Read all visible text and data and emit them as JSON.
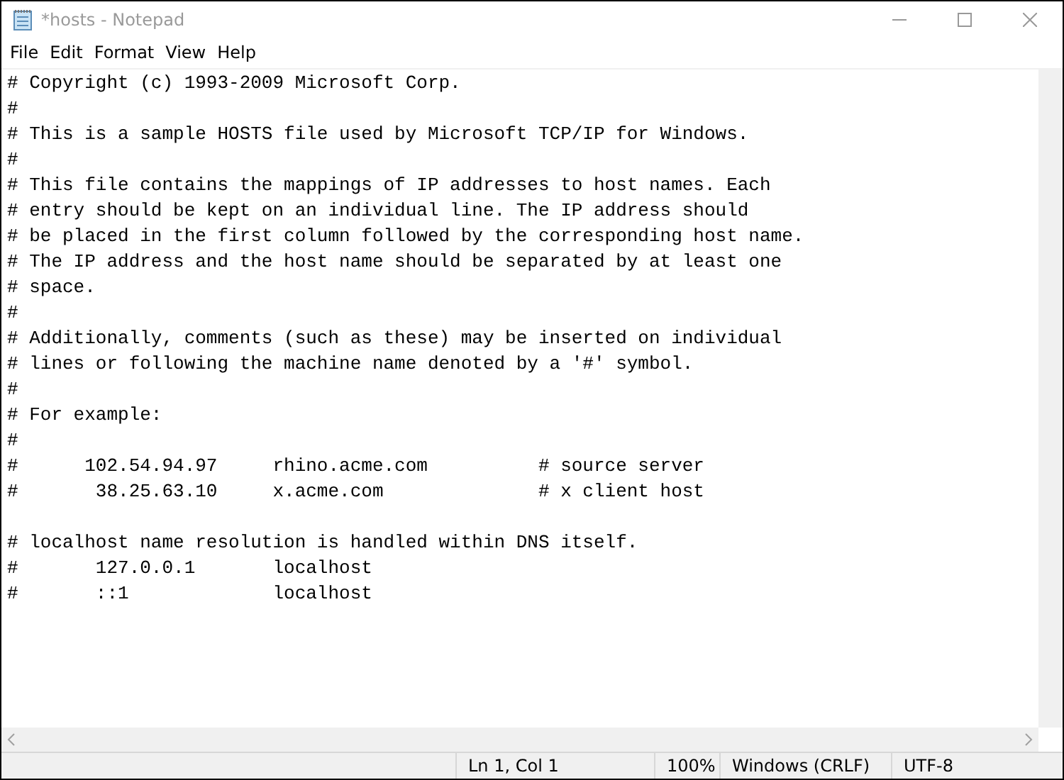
{
  "window": {
    "title": "*hosts - Notepad",
    "active": false
  },
  "menu": [
    "File",
    "Edit",
    "Format",
    "View",
    "Help"
  ],
  "editor": {
    "blocks": [
      {
        "lines": [
          "# Copyright (c) 1993-2009 Microsoft Corp.",
          "#",
          "# This is a sample HOSTS file used by Microsoft TCP/IP for Windows.",
          "#",
          "# This file contains the mappings of IP addresses to host names. Each",
          "# entry should be kept on an individual line. The IP address should",
          "# be placed in the first column followed by the corresponding host name.",
          "# The IP address and the host name should be separated by at least one",
          "# space.",
          "#",
          "# Additionally, comments (such as these) may be inserted on individual",
          "# lines or following the machine name denoted by a '#' symbol.",
          "#",
          "# For example:",
          "#",
          "#      102.54.94.97     rhino.acme.com          # source server",
          "#       38.25.63.10     x.acme.com              # x client host"
        ]
      },
      {
        "lines": [
          "# localhost name resolution is handled within DNS itself.",
          "#       127.0.0.1       localhost",
          "#       ::1             localhost"
        ]
      }
    ]
  },
  "status_bar": [
    "Ln 1, Col 1",
    "100%",
    "Windows (CRLF)",
    "UTF-8"
  ]
}
